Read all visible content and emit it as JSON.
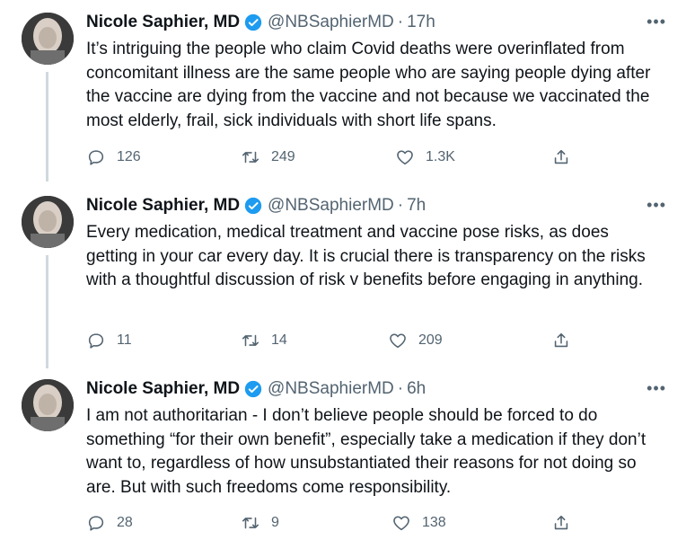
{
  "tweets": [
    {
      "author": "Nicole Saphier, MD",
      "handle": "@NBSaphierMD",
      "separator": "·",
      "time": "17h",
      "more": "•••",
      "text": "It’s intriguing the people who claim Covid deaths were overinflated from concomitant illness are the same people who are saying people dying after the vaccine are dying from the vaccine and not because we vaccinated the most elderly, frail, sick individuals with short life spans.",
      "replies": "126",
      "retweets": "249",
      "likes": "1.3K"
    },
    {
      "author": "Nicole Saphier, MD",
      "handle": "@NBSaphierMD",
      "separator": "·",
      "time": "7h",
      "more": "•••",
      "text": "Every medication, medical treatment and vaccine pose risks, as does getting in your car every day. It is crucial there is transparency on the risks with a thoughtful discussion of risk v benefits before engaging in anything.",
      "replies": "11",
      "retweets": "14",
      "likes": "209"
    },
    {
      "author": "Nicole Saphier, MD",
      "handle": "@NBSaphierMD",
      "separator": "·",
      "time": "6h",
      "more": "•••",
      "text": "I am not authoritarian  - I don’t believe people should be forced to do something “for their own benefit”, especially take a medication if they don’t want to, regardless of how unsubstantiated their reasons for not doing so are. But with such freedoms come responsibility.",
      "replies": "28",
      "retweets": "9",
      "likes": "138"
    }
  ],
  "colors": {
    "verified": "#1d9bf0",
    "secondary_text": "#536471",
    "thread_line": "#cfd9de"
  },
  "icons": {
    "verified": "verified-badge-icon",
    "reply": "reply-icon",
    "retweet": "retweet-icon",
    "like": "heart-icon",
    "share": "share-icon",
    "more": "more-icon"
  }
}
